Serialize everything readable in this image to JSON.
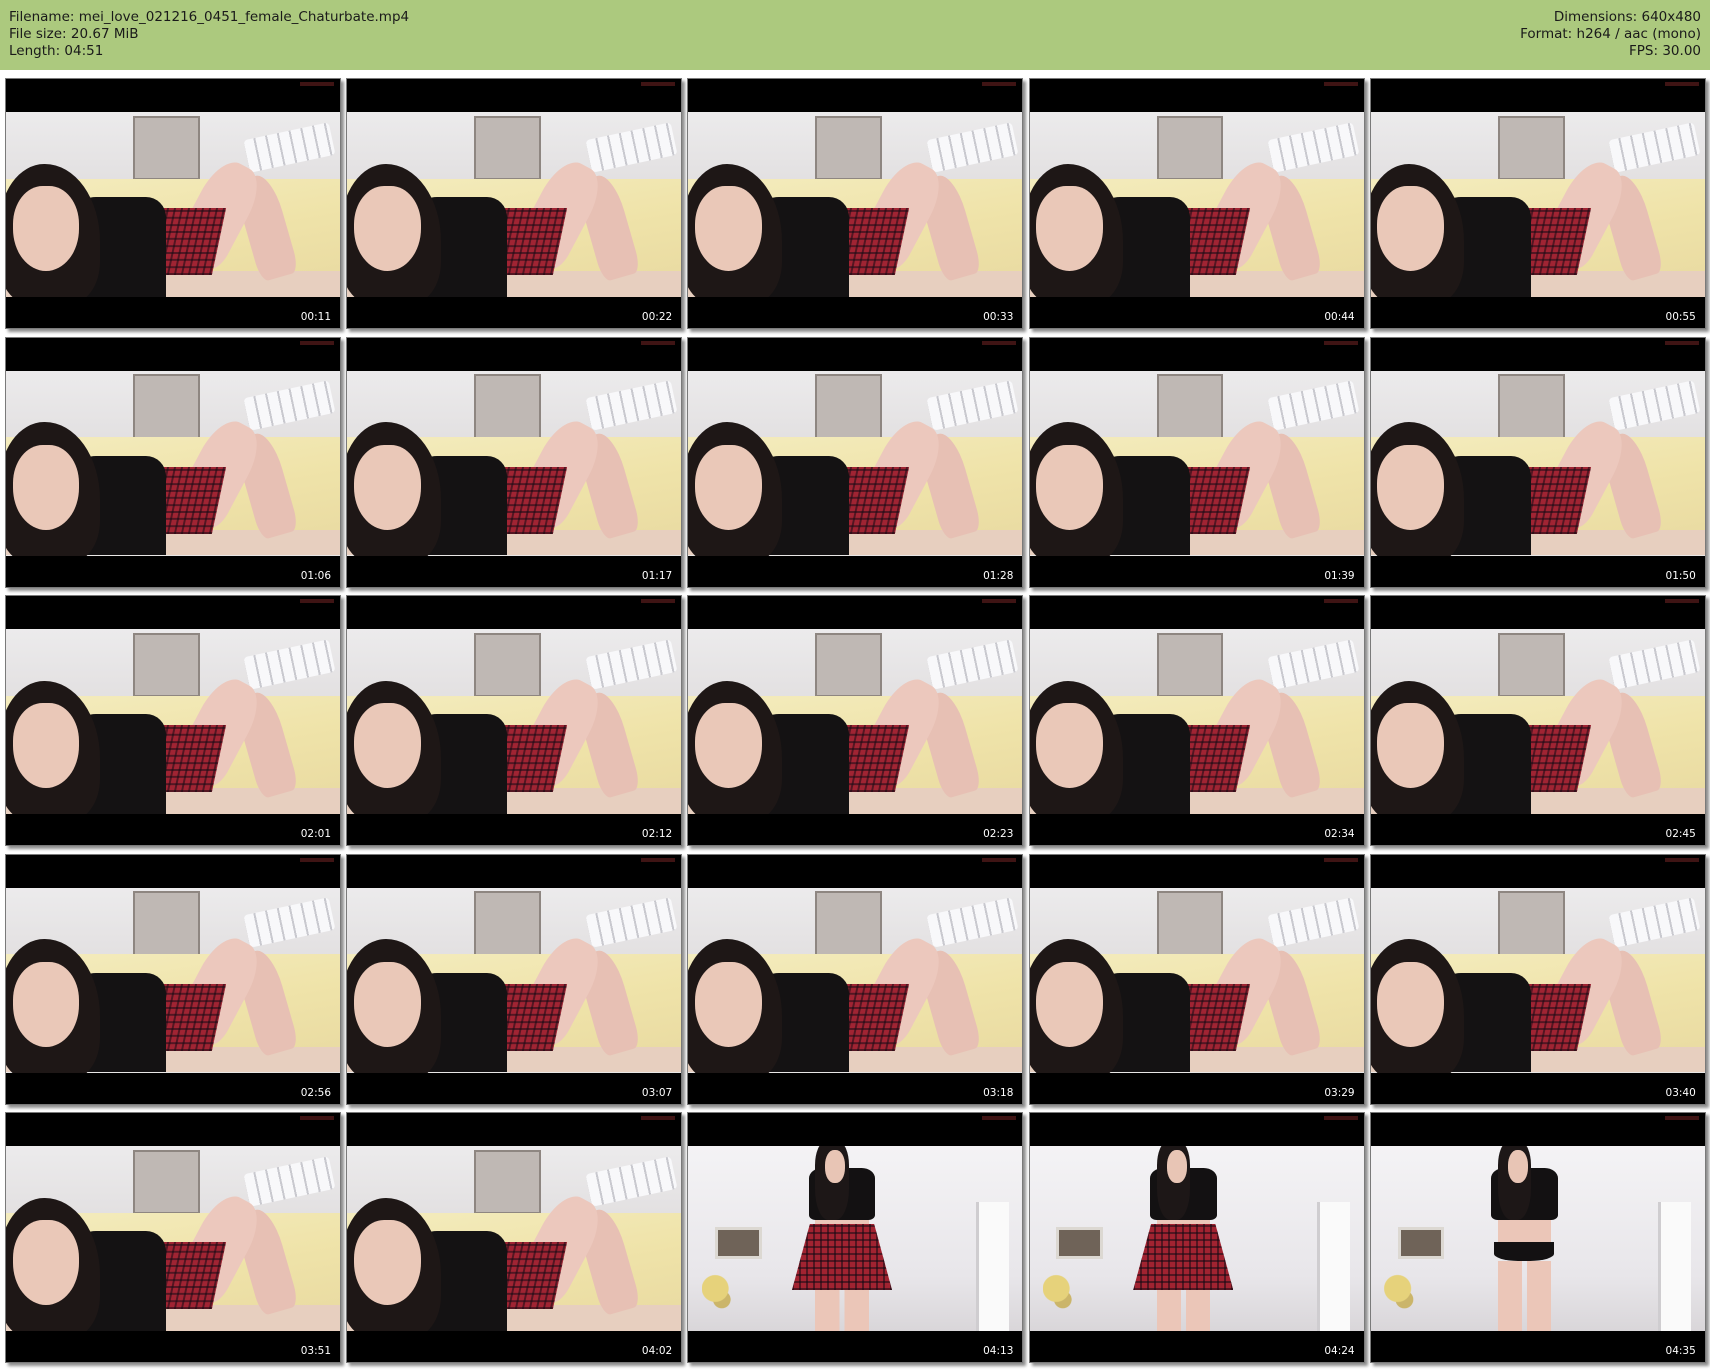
{
  "header": {
    "filename_line": "Filename: mei_love_021216_0451_female_Chaturbate.mp4",
    "filesize_line": "File size: 20.67 MiB",
    "length_line": "Length: 04:51",
    "dimensions_line": "Dimensions: 640x480",
    "format_line": "Format: h264 / aac (mono)",
    "fps_line": "FPS: 30.00",
    "background_color": "#acc97e"
  },
  "thumbnails": [
    {
      "timestamp": "00:11",
      "scene": "lying"
    },
    {
      "timestamp": "00:22",
      "scene": "lying"
    },
    {
      "timestamp": "00:33",
      "scene": "lying"
    },
    {
      "timestamp": "00:44",
      "scene": "lying"
    },
    {
      "timestamp": "00:55",
      "scene": "lying"
    },
    {
      "timestamp": "01:06",
      "scene": "lying"
    },
    {
      "timestamp": "01:17",
      "scene": "lying"
    },
    {
      "timestamp": "01:28",
      "scene": "lying"
    },
    {
      "timestamp": "01:39",
      "scene": "lying"
    },
    {
      "timestamp": "01:50",
      "scene": "lying"
    },
    {
      "timestamp": "02:01",
      "scene": "lying"
    },
    {
      "timestamp": "02:12",
      "scene": "lying"
    },
    {
      "timestamp": "02:23",
      "scene": "lying"
    },
    {
      "timestamp": "02:34",
      "scene": "lying"
    },
    {
      "timestamp": "02:45",
      "scene": "lying"
    },
    {
      "timestamp": "02:56",
      "scene": "lying"
    },
    {
      "timestamp": "03:07",
      "scene": "lying"
    },
    {
      "timestamp": "03:18",
      "scene": "lying"
    },
    {
      "timestamp": "03:29",
      "scene": "lying"
    },
    {
      "timestamp": "03:40",
      "scene": "lying"
    },
    {
      "timestamp": "03:51",
      "scene": "lying"
    },
    {
      "timestamp": "04:02",
      "scene": "lying"
    },
    {
      "timestamp": "04:13",
      "scene": "standing-skirt"
    },
    {
      "timestamp": "04:24",
      "scene": "standing-skirt"
    },
    {
      "timestamp": "04:35",
      "scene": "standing"
    }
  ]
}
